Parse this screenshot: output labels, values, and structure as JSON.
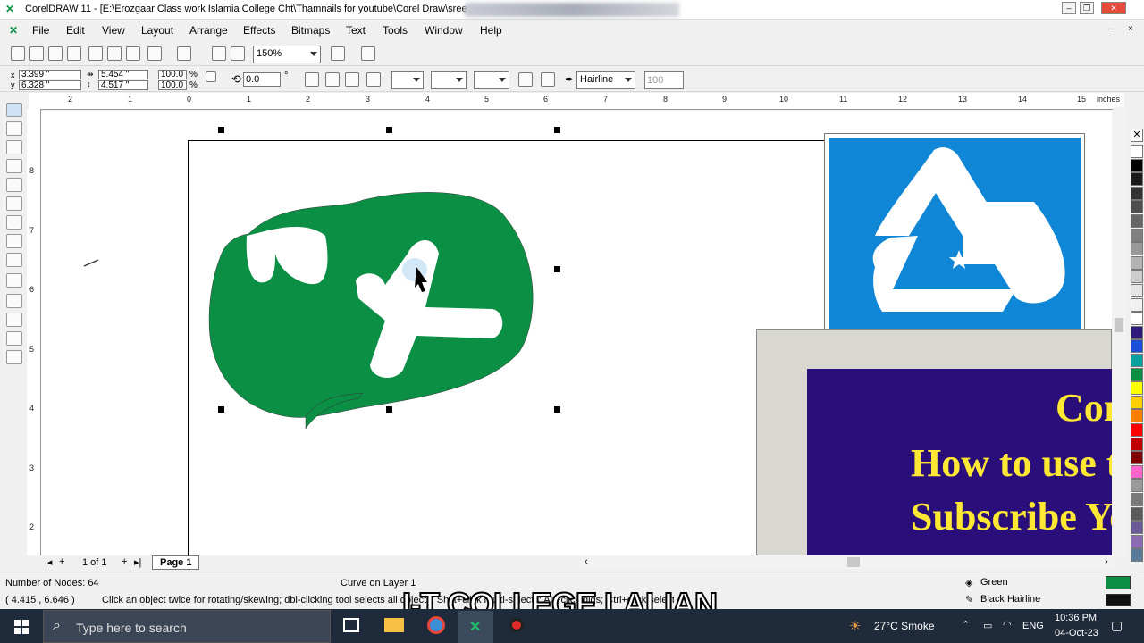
{
  "title_bar": {
    "app_title": "CorelDRAW 11 - [E:\\Erozgaar Class work Islamia College Cht\\Thamnails for youtube\\Corel Draw\\sree"
  },
  "menu": [
    "File",
    "Edit",
    "View",
    "Layout",
    "Arrange",
    "Effects",
    "Bitmaps",
    "Text",
    "Tools",
    "Window",
    "Help"
  ],
  "toolbar": {
    "zoom": "150%"
  },
  "property_bar": {
    "x": "3.399 \"",
    "y": "6.328 \"",
    "width": "5.454 \"",
    "height": "4.517 \"",
    "scale_x": "100.0",
    "scale_y": "100.0",
    "scale_unit": "%",
    "rotation": "0.0",
    "rotation_unit": "°",
    "outline_width": "Hairline",
    "opacity": "100"
  },
  "ruler": {
    "unit": "inches",
    "h_ticks": [
      "2",
      "1",
      "0",
      "1",
      "2",
      "3",
      "4",
      "5",
      "6",
      "7",
      "8",
      "9",
      "10",
      "11",
      "12",
      "13",
      "14",
      "15"
    ],
    "v_ticks": [
      "8",
      "7",
      "6",
      "5",
      "4",
      "3",
      "2"
    ]
  },
  "page_nav": {
    "page_count": "1 of 1",
    "tab": "Page 1"
  },
  "thumbnail": {
    "line1": "Core",
    "line2": "How to use too",
    "line3": "Subscribe YouT"
  },
  "status": {
    "nodes": "Number of Nodes: 64",
    "object": "Curve on Layer 1",
    "coords": "( 4.415 , 6.646 )",
    "hint": "Click an object twice for rotating/skewing; dbl-clicking tool selects all objects; Shift+click multi-selects; Alt+click digs; Ctrl+click selects in a group",
    "fill_name": "Green",
    "outline_name": "Black  Hairline",
    "fill_color": "#0a8f45",
    "outline_color": "#111111"
  },
  "overlay_caption": "I-T COLLEGE LALIAN",
  "taskbar": {
    "search_placeholder": "Type here to search",
    "weather": "27°C  Smoke",
    "lang": "ENG",
    "time": "10:36 PM",
    "date": "04-Oct-23"
  },
  "palette_colors": [
    "#ffffff",
    "#000000",
    "#1a1a1a",
    "#333333",
    "#4d4d4d",
    "#666666",
    "#808080",
    "#999999",
    "#b3b3b3",
    "#cccccc",
    "#e6e6e6",
    "#f2f2f2",
    "#ffffff",
    "#2f1a7a",
    "#1c4fd8",
    "#0aa0a0",
    "#0a8f45",
    "#ffff00",
    "#ffd000",
    "#ff8000",
    "#ff0000",
    "#c00000",
    "#800000",
    "#ff66cc",
    "#9a9a9a",
    "#7a7a7a",
    "#5a5a5a",
    "#6a5a9a",
    "#8a6ab0",
    "#5a7a9a"
  ],
  "colors": {
    "accent_green": "#0a8f45",
    "thumb_blue": "#0f86d6",
    "thumb_purple": "#2a0f7a",
    "thumb_yellow": "#ffe833"
  }
}
